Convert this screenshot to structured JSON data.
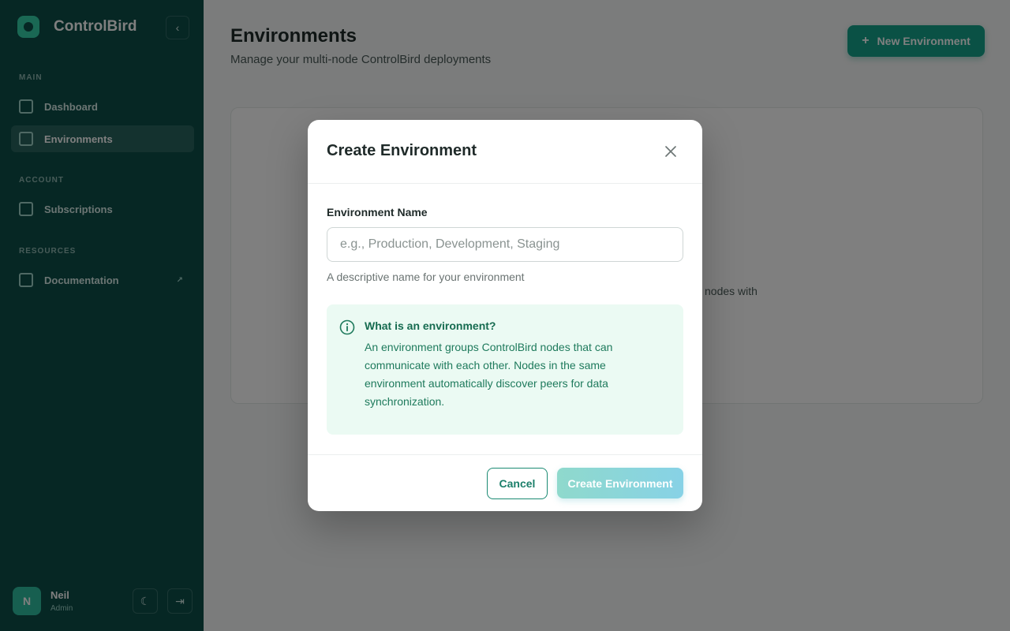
{
  "sidebar": {
    "brand": "ControlBird",
    "sections": [
      {
        "label": "MAIN"
      },
      {
        "label": "ACCOUNT"
      },
      {
        "label": "RESOURCES"
      }
    ],
    "items": [
      {
        "label": "Dashboard"
      },
      {
        "label": "Environments"
      },
      {
        "label": "Subscriptions"
      },
      {
        "label": "Documentation"
      }
    ],
    "user": {
      "name": "Neil",
      "role": "Admin",
      "initial": "N"
    }
  },
  "main": {
    "title": "Environments",
    "subtitle": "Manage your multi-node ControlBird deployments",
    "new_button": "New Environment",
    "empty_text_fragment": "nodes with"
  },
  "modal": {
    "title": "Create Environment",
    "field_label": "Environment Name",
    "input_value": "",
    "input_placeholder": "e.g., Production, Development, Staging",
    "help_text": "A descriptive name for your environment",
    "info_title": "What is an environment?",
    "info_text": "An environment groups ControlBird nodes that can communicate with each other. Nodes in the same environment automatically discover peers for data synchronization.",
    "cancel_label": "Cancel",
    "create_label": "Create Environment"
  },
  "colors": {
    "sidebar_bg": "#0c4f49",
    "accent": "#14a38a",
    "info_bg": "#ebfaf3",
    "info_text": "#1e7a5c"
  }
}
